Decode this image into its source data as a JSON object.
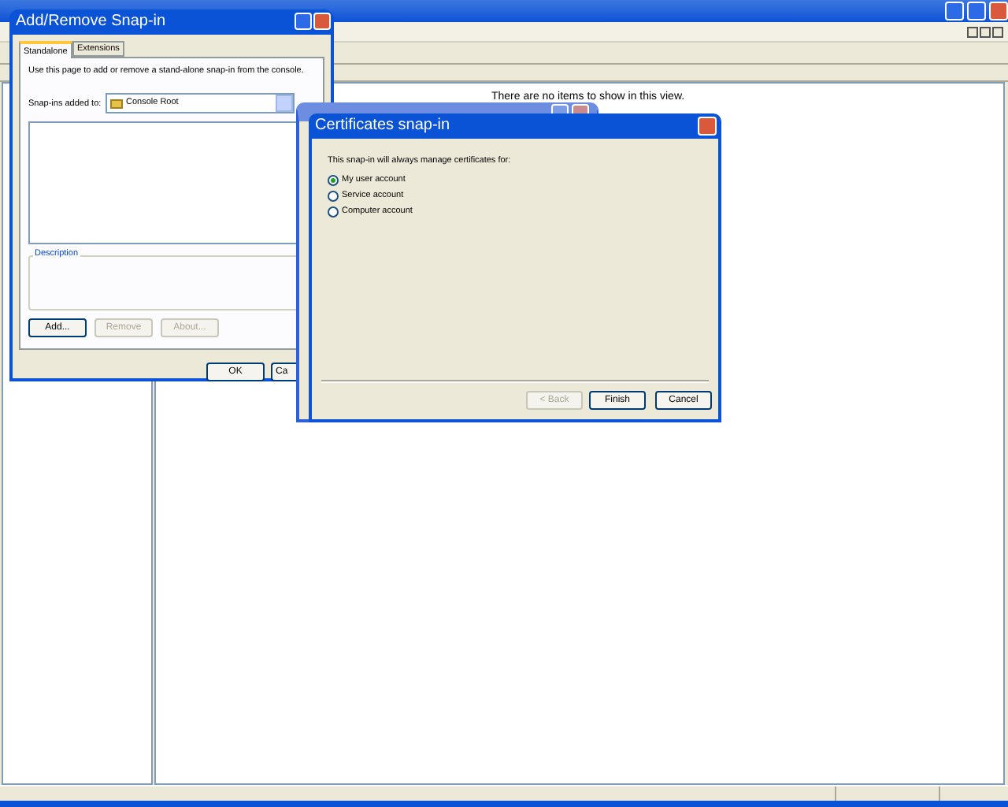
{
  "details_pane": {
    "empty_message": "There are no items to show in this view."
  },
  "add_remove_dialog": {
    "title": "Add/Remove Snap-in",
    "tabs": [
      {
        "label": "Standalone",
        "selected": true
      },
      {
        "label": "Extensions",
        "selected": false
      }
    ],
    "intro": "Use this page to add or remove a stand-alone snap-in from the console.",
    "snapins_label": "Snap-ins added to:",
    "snapins_value": "Console Root",
    "description_label": "Description",
    "buttons": [
      {
        "label": "Add...",
        "disabled": false
      },
      {
        "label": "Remove",
        "disabled": true
      },
      {
        "label": "About...",
        "disabled": true
      }
    ],
    "footer_buttons": [
      {
        "label": "OK"
      },
      {
        "label": "Ca"
      }
    ]
  },
  "certificates_dialog": {
    "title": "Certificates snap-in",
    "prompt": "This snap-in will always manage certificates for:",
    "options": [
      {
        "label": "My user account",
        "selected": true
      },
      {
        "label": "Service account",
        "selected": false
      },
      {
        "label": "Computer account",
        "selected": false
      }
    ],
    "buttons": [
      {
        "label": "< Back",
        "disabled": true
      },
      {
        "label": "Finish",
        "disabled": false
      },
      {
        "label": "Cancel",
        "disabled": false
      }
    ]
  }
}
